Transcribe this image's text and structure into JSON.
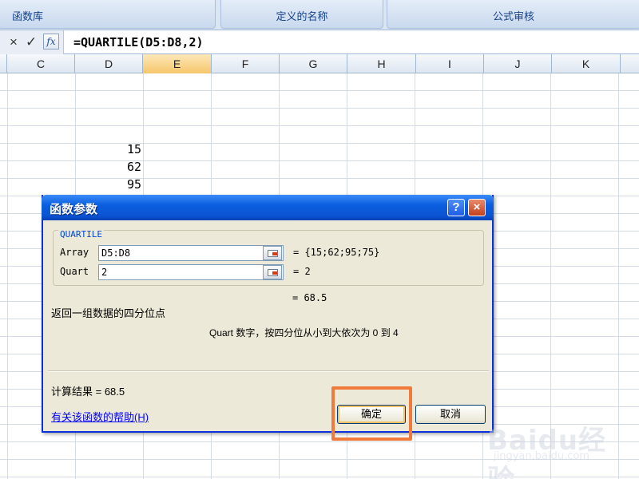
{
  "ribbon": {
    "groups": [
      "函数库",
      "定义的名称",
      "公式审核"
    ]
  },
  "formula_bar": {
    "cancel_icon": "×",
    "enter_icon": "✓",
    "fx_label": "fx",
    "formula": "=QUARTILE(D5:D8,2)"
  },
  "columns": [
    "C",
    "D",
    "E",
    "F",
    "G",
    "H",
    "I",
    "J",
    "K"
  ],
  "selected_column": "E",
  "cells": {
    "d5": "15",
    "d6": "62",
    "d7": "95"
  },
  "dialog": {
    "title": "函数参数",
    "help_button": "?",
    "close_button": "×",
    "function_name": "QUARTILE",
    "args": [
      {
        "label": "Array",
        "value": "D5:D8",
        "result": "=  {15;62;95;75}"
      },
      {
        "label": "Quart",
        "value": "2",
        "result": "=  2"
      }
    ],
    "formula_result": "=  68.5",
    "description": "返回一组数据的四分位点",
    "arg_help": "Quart  数字，按四分位从小到大依次为 0 到 4",
    "calc_result": "计算结果 =  68.5",
    "help_link": "有关该函数的帮助(H)",
    "ok_label": "确定",
    "cancel_label": "取消"
  },
  "watermark": {
    "logo": "Baidu经验",
    "url": "jingyan.baidu.com"
  },
  "colors": {
    "title_bar": "#0b55d3",
    "dialog_bg": "#ece9d8",
    "highlight": "#f07a3c",
    "selected_column": "#f6c66a",
    "link": "#0000ff"
  }
}
